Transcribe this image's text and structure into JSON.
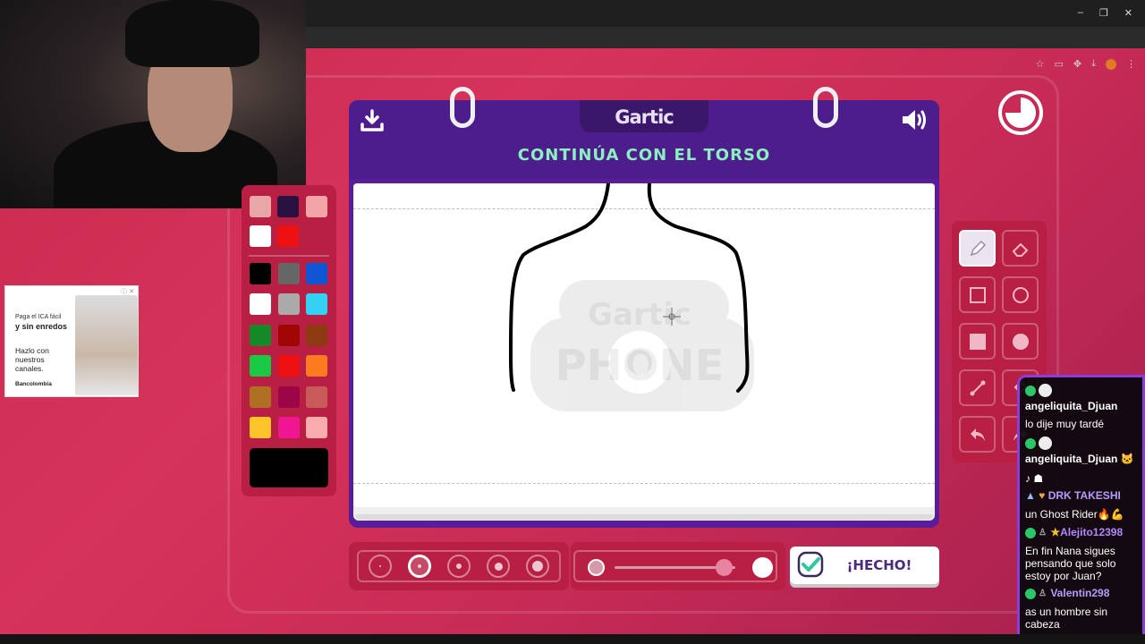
{
  "browser": {
    "window_controls": [
      "–",
      "❐",
      "✕"
    ],
    "toolbar_icons": [
      "star-icon",
      "cast-icon",
      "extensions-icon",
      "download-icon",
      "profile-icon",
      "menu-icon"
    ]
  },
  "ad": {
    "line1": "Paga el ICA fácil",
    "line2": "y sin enredos",
    "line3": "Hazlo con nuestros canales.",
    "brand": "Bancolombia",
    "close": "ⓘ ✕"
  },
  "game": {
    "logo": "Gartic",
    "prompt": "CONTINÚA CON EL TORSO",
    "watermark_top": "Gartic",
    "watermark_bottom": "PHONE",
    "done_label": "¡HECHO!",
    "brush_size_selected": 2,
    "opacity_level": 0.9
  },
  "palette": {
    "colors_top": [
      "#e8a6a6",
      "#29123f",
      "#f3a4a4",
      "#ffffff",
      "#ef1111"
    ],
    "colors_grid": [
      "#000000",
      "#666666",
      "#0f55d4",
      "#ffffff",
      "#aaaaaa",
      "#33d2f5",
      "#138a27",
      "#a10505",
      "#8d3a12",
      "#1ac944",
      "#ef1111",
      "#fb7b1e",
      "#b07024",
      "#9c0548",
      "#c95a5a",
      "#fcc32a",
      "#f01693",
      "#f9acac"
    ],
    "current_color": "#000000"
  },
  "chat": {
    "messages": [
      {
        "user": "angeliquita_Djuan",
        "text": "lo dije muy tardé",
        "color": "#ffffff"
      },
      {
        "user": "angeliquita_Djuan 🐱",
        "text": "",
        "color": "#ffffff"
      },
      {
        "user": "DRK TAKESHI",
        "text": "un Ghost Rider🔥💪",
        "color": "#b79cff"
      },
      {
        "user": "Alejito12398",
        "text": "En fin Nana sigues pensando que solo estoy por Juan?",
        "color": "#b687ff"
      },
      {
        "user": "Valentin298",
        "text": "as un hombre sin cabeza",
        "color": "#b79cff"
      }
    ]
  }
}
